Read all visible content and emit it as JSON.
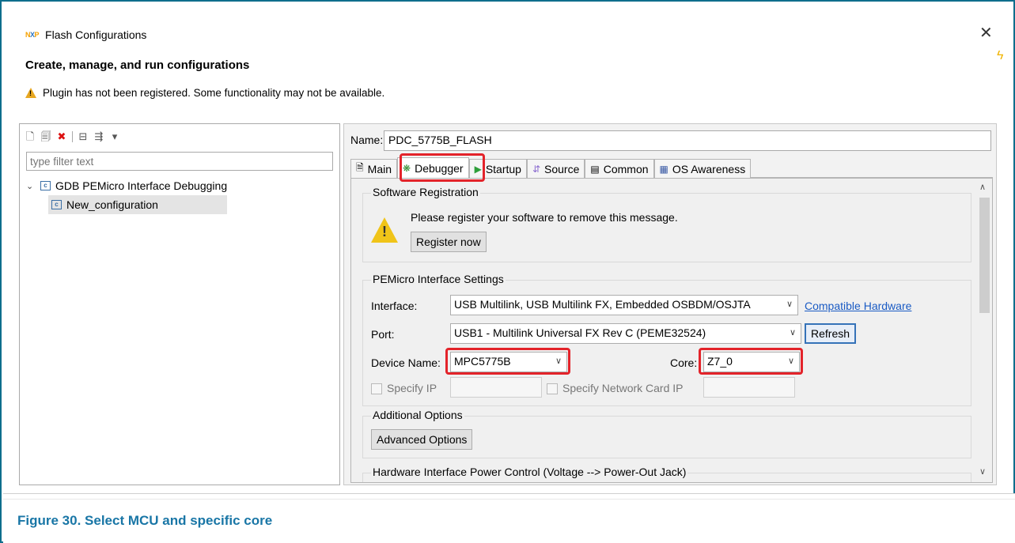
{
  "dialog": {
    "title": "Flash Configurations",
    "close_glyph": "✕",
    "heading": "Create, manage, and run configurations",
    "warning": "Plugin has not been registered. Some functionality may not be available."
  },
  "left": {
    "filter_placeholder": "type filter text",
    "tree": {
      "group": "GDB PEMicro Interface Debugging",
      "child": "New_configuration"
    }
  },
  "right": {
    "name_label": "Name:",
    "name_value": "PDC_5775B_FLASH",
    "tabs": [
      {
        "label": "Main",
        "icon": "main-tab-icon"
      },
      {
        "label": "Debugger",
        "icon": "debugger-tab-icon",
        "active": true
      },
      {
        "label": "Startup",
        "icon": "startup-tab-icon"
      },
      {
        "label": "Source",
        "icon": "source-tab-icon"
      },
      {
        "label": "Common",
        "icon": "common-tab-icon"
      },
      {
        "label": "OS Awareness",
        "icon": "os-awareness-tab-icon"
      }
    ],
    "software_registration": {
      "title": "Software Registration",
      "message": "Please register your software to remove this message.",
      "button": "Register now"
    },
    "pemicro": {
      "title": "PEMicro Interface Settings",
      "interface_label": "Interface:",
      "interface_value": "USB Multilink, USB Multilink FX, Embedded OSBDM/OSJTA",
      "compatible_link": "Compatible Hardware",
      "port_label": "Port:",
      "port_value": "USB1 - Multilink Universal FX Rev C (PEME32524)",
      "refresh": "Refresh",
      "device_label": "Device Name:",
      "device_value": "MPC5775B",
      "core_label": "Core:",
      "core_value": "Z7_0",
      "specify_ip": "Specify IP",
      "specify_nic": "Specify Network Card IP"
    },
    "additional": {
      "title": "Additional Options",
      "button": "Advanced Options"
    },
    "hw_power": {
      "title": "Hardware Interface Power Control (Voltage --> Power-Out Jack)"
    }
  },
  "caption": "Figure 30. Select MCU and specific core",
  "colors": {
    "highlight": "#e3232a",
    "caption": "#1976a6",
    "frame": "#0e6e8c"
  }
}
